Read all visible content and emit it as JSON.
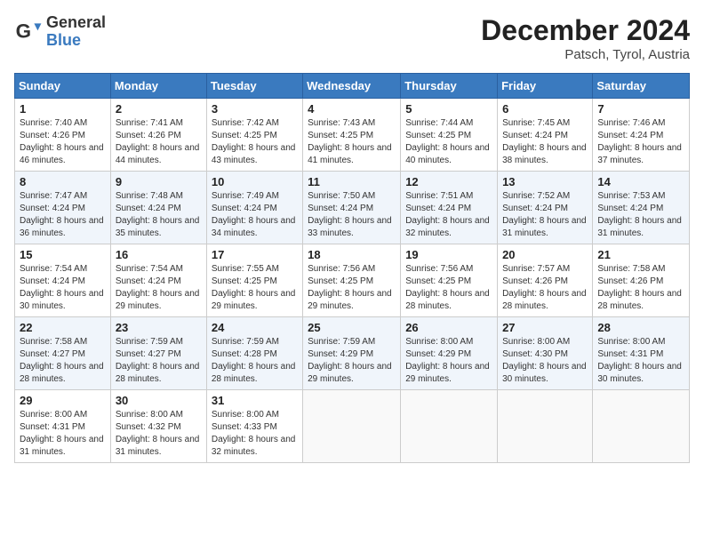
{
  "header": {
    "logo_general": "General",
    "logo_blue": "Blue",
    "month_title": "December 2024",
    "location": "Patsch, Tyrol, Austria"
  },
  "days_of_week": [
    "Sunday",
    "Monday",
    "Tuesday",
    "Wednesday",
    "Thursday",
    "Friday",
    "Saturday"
  ],
  "weeks": [
    [
      {
        "day": "1",
        "sunrise": "7:40 AM",
        "sunset": "4:26 PM",
        "daylight": "8 hours and 46 minutes."
      },
      {
        "day": "2",
        "sunrise": "7:41 AM",
        "sunset": "4:26 PM",
        "daylight": "8 hours and 44 minutes."
      },
      {
        "day": "3",
        "sunrise": "7:42 AM",
        "sunset": "4:25 PM",
        "daylight": "8 hours and 43 minutes."
      },
      {
        "day": "4",
        "sunrise": "7:43 AM",
        "sunset": "4:25 PM",
        "daylight": "8 hours and 41 minutes."
      },
      {
        "day": "5",
        "sunrise": "7:44 AM",
        "sunset": "4:25 PM",
        "daylight": "8 hours and 40 minutes."
      },
      {
        "day": "6",
        "sunrise": "7:45 AM",
        "sunset": "4:24 PM",
        "daylight": "8 hours and 38 minutes."
      },
      {
        "day": "7",
        "sunrise": "7:46 AM",
        "sunset": "4:24 PM",
        "daylight": "8 hours and 37 minutes."
      }
    ],
    [
      {
        "day": "8",
        "sunrise": "7:47 AM",
        "sunset": "4:24 PM",
        "daylight": "8 hours and 36 minutes."
      },
      {
        "day": "9",
        "sunrise": "7:48 AM",
        "sunset": "4:24 PM",
        "daylight": "8 hours and 35 minutes."
      },
      {
        "day": "10",
        "sunrise": "7:49 AM",
        "sunset": "4:24 PM",
        "daylight": "8 hours and 34 minutes."
      },
      {
        "day": "11",
        "sunrise": "7:50 AM",
        "sunset": "4:24 PM",
        "daylight": "8 hours and 33 minutes."
      },
      {
        "day": "12",
        "sunrise": "7:51 AM",
        "sunset": "4:24 PM",
        "daylight": "8 hours and 32 minutes."
      },
      {
        "day": "13",
        "sunrise": "7:52 AM",
        "sunset": "4:24 PM",
        "daylight": "8 hours and 31 minutes."
      },
      {
        "day": "14",
        "sunrise": "7:53 AM",
        "sunset": "4:24 PM",
        "daylight": "8 hours and 31 minutes."
      }
    ],
    [
      {
        "day": "15",
        "sunrise": "7:54 AM",
        "sunset": "4:24 PM",
        "daylight": "8 hours and 30 minutes."
      },
      {
        "day": "16",
        "sunrise": "7:54 AM",
        "sunset": "4:24 PM",
        "daylight": "8 hours and 29 minutes."
      },
      {
        "day": "17",
        "sunrise": "7:55 AM",
        "sunset": "4:25 PM",
        "daylight": "8 hours and 29 minutes."
      },
      {
        "day": "18",
        "sunrise": "7:56 AM",
        "sunset": "4:25 PM",
        "daylight": "8 hours and 29 minutes."
      },
      {
        "day": "19",
        "sunrise": "7:56 AM",
        "sunset": "4:25 PM",
        "daylight": "8 hours and 28 minutes."
      },
      {
        "day": "20",
        "sunrise": "7:57 AM",
        "sunset": "4:26 PM",
        "daylight": "8 hours and 28 minutes."
      },
      {
        "day": "21",
        "sunrise": "7:58 AM",
        "sunset": "4:26 PM",
        "daylight": "8 hours and 28 minutes."
      }
    ],
    [
      {
        "day": "22",
        "sunrise": "7:58 AM",
        "sunset": "4:27 PM",
        "daylight": "8 hours and 28 minutes."
      },
      {
        "day": "23",
        "sunrise": "7:59 AM",
        "sunset": "4:27 PM",
        "daylight": "8 hours and 28 minutes."
      },
      {
        "day": "24",
        "sunrise": "7:59 AM",
        "sunset": "4:28 PM",
        "daylight": "8 hours and 28 minutes."
      },
      {
        "day": "25",
        "sunrise": "7:59 AM",
        "sunset": "4:29 PM",
        "daylight": "8 hours and 29 minutes."
      },
      {
        "day": "26",
        "sunrise": "8:00 AM",
        "sunset": "4:29 PM",
        "daylight": "8 hours and 29 minutes."
      },
      {
        "day": "27",
        "sunrise": "8:00 AM",
        "sunset": "4:30 PM",
        "daylight": "8 hours and 30 minutes."
      },
      {
        "day": "28",
        "sunrise": "8:00 AM",
        "sunset": "4:31 PM",
        "daylight": "8 hours and 30 minutes."
      }
    ],
    [
      {
        "day": "29",
        "sunrise": "8:00 AM",
        "sunset": "4:31 PM",
        "daylight": "8 hours and 31 minutes."
      },
      {
        "day": "30",
        "sunrise": "8:00 AM",
        "sunset": "4:32 PM",
        "daylight": "8 hours and 31 minutes."
      },
      {
        "day": "31",
        "sunrise": "8:00 AM",
        "sunset": "4:33 PM",
        "daylight": "8 hours and 32 minutes."
      },
      null,
      null,
      null,
      null
    ]
  ],
  "labels": {
    "sunrise": "Sunrise:",
    "sunset": "Sunset:",
    "daylight": "Daylight:"
  }
}
